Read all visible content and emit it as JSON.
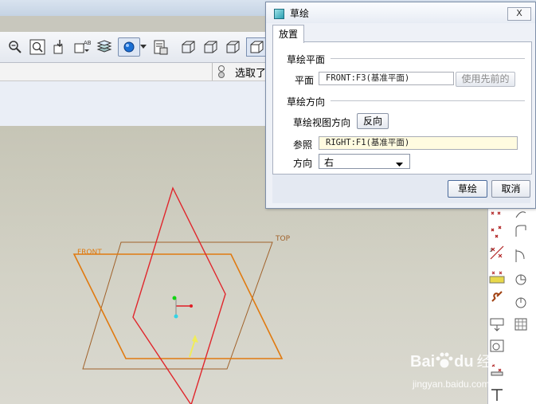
{
  "colors": {
    "dialog_bg": "#eef1f7",
    "viewport_bg": "#cfcec2",
    "plane_orange": "#c87a1e",
    "plane_red": "#e02626",
    "ref_field_bg": "#fffbe0",
    "axis_green": "#11d411",
    "axis_cyan": "#31d4e6",
    "axis_red": "#e01c24",
    "arrow_yellow": "#f0ec5a"
  },
  "toolbar": {
    "icons": [
      "zoom-out-icon",
      "zoom-window-icon",
      "orient-icon",
      "saved-view-icon",
      "layers-icon",
      "display-style-icon",
      "dropdown-arrow-icon",
      "model-tree-icon",
      "wireframe-icon",
      "hidden-line-icon",
      "no-hidden-icon",
      "shaded-icon"
    ]
  },
  "selection": {
    "label": "选取了"
  },
  "viewport": {
    "labels": {
      "front": "FRONT",
      "top": "TOP"
    }
  },
  "dialog": {
    "title": "草绘",
    "close_label": "X",
    "tab_label": "放置",
    "sketch_plane": {
      "section_title": "草绘平面",
      "plane_label": "平面",
      "plane_value": "FRONT:F3(基准平面)",
      "use_previous_button": "使用先前的"
    },
    "orientation": {
      "section_title": "草绘方向",
      "view_direction_label": "草绘视图方向",
      "flip_button": "反向",
      "reference_label": "参照",
      "reference_value": "RIGHT:F1(基准平面)",
      "direction_label": "方向",
      "direction_value": "右"
    },
    "sketch_button": "草绘",
    "cancel_button": "取消"
  },
  "watermark": {
    "brand": "Bai",
    "brand_suffix": "du",
    "product": "经验",
    "url": "jingyan.baidu.com"
  }
}
